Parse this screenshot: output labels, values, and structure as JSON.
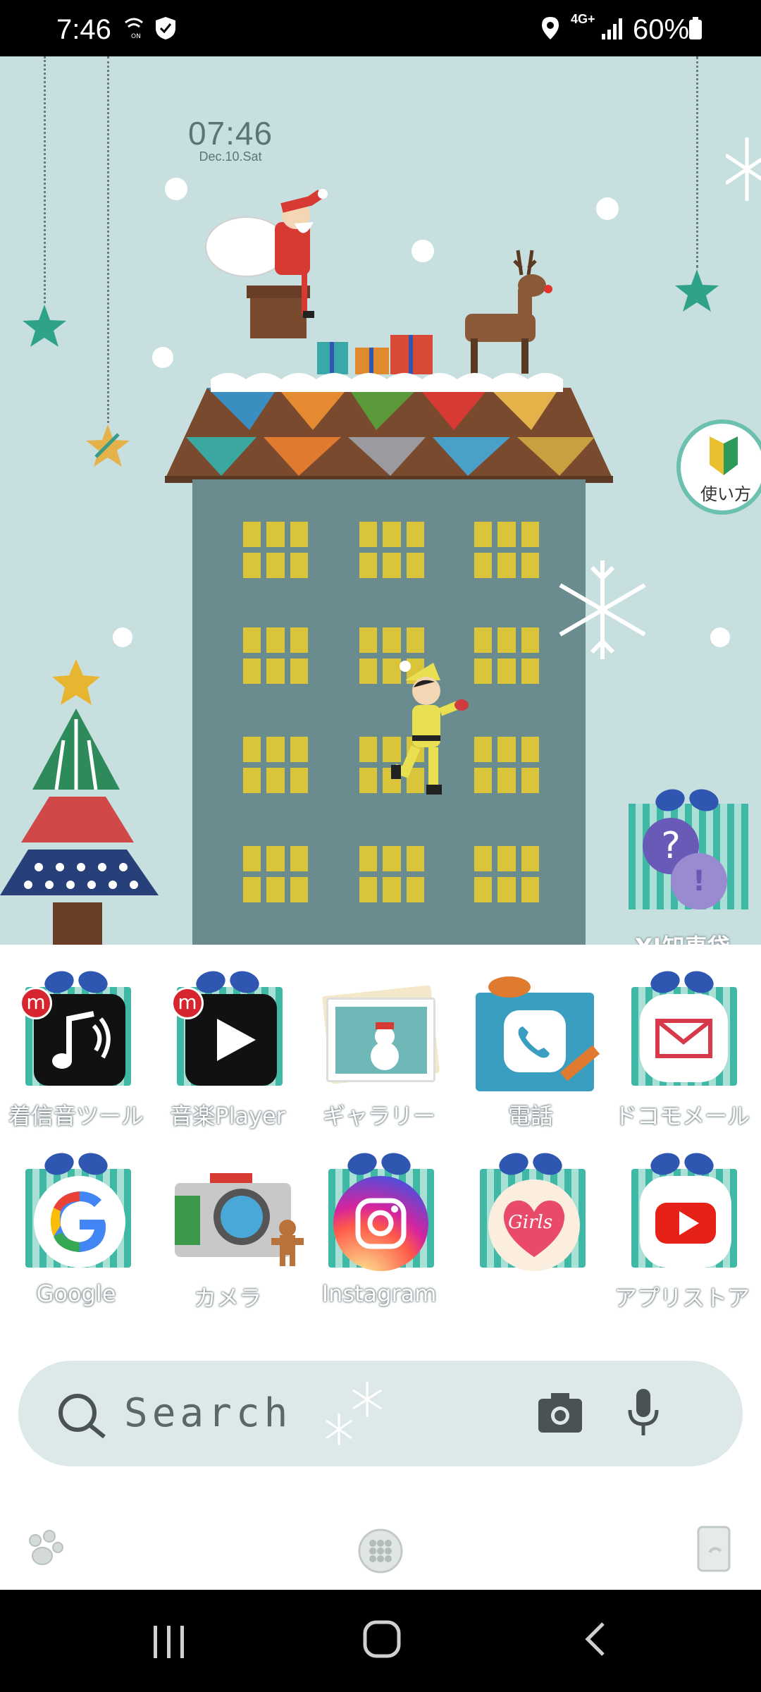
{
  "status_bar": {
    "time": "7:46",
    "network": "4G+",
    "battery": "60%"
  },
  "clock_widget": {
    "time": "07:46",
    "date": "Dec.10.Sat"
  },
  "widgets": {
    "howto_label": "使い方",
    "chiebukuro_label": "Y!知恵袋"
  },
  "apps_row1": [
    {
      "label": "着信音ツール",
      "icon": "music-note-icon"
    },
    {
      "label": "音楽Player",
      "icon": "play-icon"
    },
    {
      "label": "ギャラリー",
      "icon": "gallery-icon"
    },
    {
      "label": "電話",
      "icon": "phone-icon"
    },
    {
      "label": "ドコモメール",
      "icon": "mail-icon"
    }
  ],
  "apps_row2": [
    {
      "label": "Google",
      "icon": "google-icon"
    },
    {
      "label": "カメラ",
      "icon": "camera-icon"
    },
    {
      "label": "Instagram",
      "icon": "instagram-icon"
    },
    {
      "label": "",
      "icon": "girls-icon",
      "badge": "Girls"
    },
    {
      "label": "アプリストア",
      "icon": "youtube-icon"
    }
  ],
  "search": {
    "placeholder": "Search"
  },
  "colors": {
    "sky": "#c8dfe0",
    "building": "#6a8c8e",
    "window": "#d9c43a",
    "gift_stripe": "#3fb9a6",
    "bow": "#2f56b0"
  }
}
